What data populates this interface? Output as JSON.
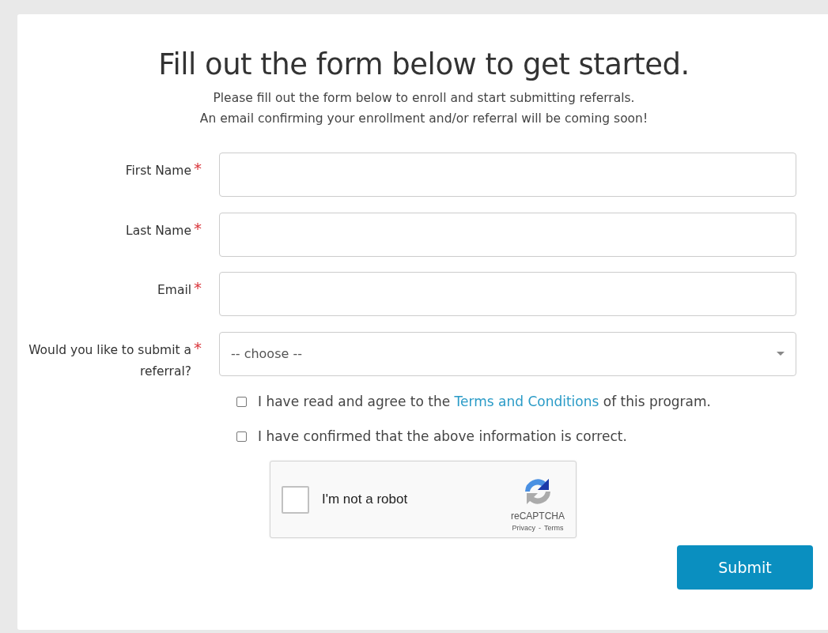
{
  "heading": "Fill out the form below to get started.",
  "intro": [
    "Please fill out the form below to enroll and start submitting referrals.",
    "An email confirming your enrollment and/or referral will be coming soon!"
  ],
  "fields": [
    {
      "kind": "text",
      "label": "First Name",
      "required_mark": "*"
    },
    {
      "kind": "text",
      "label": "Last Name",
      "required_mark": "*"
    },
    {
      "kind": "text",
      "label": "Email",
      "required_mark": "*"
    },
    {
      "kind": "select",
      "label": "Would you like to submit a referral?",
      "required_mark": "*",
      "value": "-- choose --"
    }
  ],
  "agreements": [
    {
      "text_before": "I have read and agree to the",
      "link": "Terms and Conditions",
      "text_after": "of this program.",
      "checked": false
    },
    {
      "text_before": "I have confirmed that the above information is correct.",
      "checked": false
    }
  ],
  "captcha": {
    "label": "I'm not a robot",
    "checked": false,
    "brand": "reCAPTCHA",
    "privacy": "Privacy",
    "separator": "-",
    "terms": "Terms"
  },
  "submit": "Submit"
}
